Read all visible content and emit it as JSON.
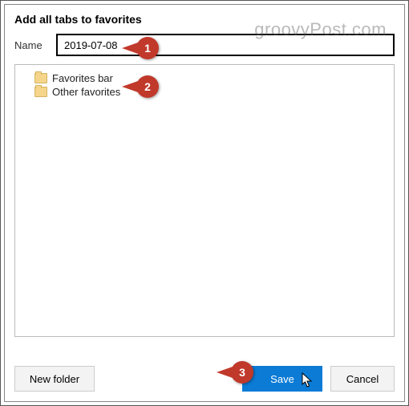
{
  "title": "Add all tabs to favorites",
  "name_label": "Name",
  "name_value": "2019-07-08",
  "folders": [
    {
      "label": "Favorites bar"
    },
    {
      "label": "Other favorites"
    }
  ],
  "buttons": {
    "new_folder": "New folder",
    "save": "Save",
    "cancel": "Cancel"
  },
  "watermark": "groovyPost.com",
  "callouts": {
    "c1": "1",
    "c2": "2",
    "c3": "3"
  }
}
